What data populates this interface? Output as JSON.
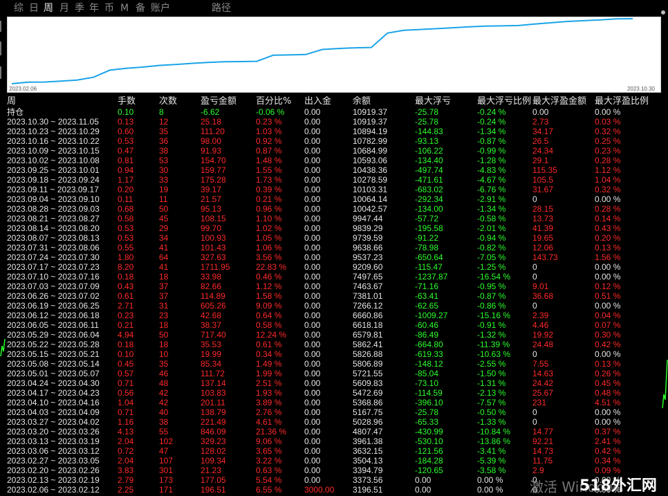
{
  "tabs": [
    {
      "label": "综"
    },
    {
      "label": "日"
    },
    {
      "label": "周",
      "active": true
    },
    {
      "label": "月"
    },
    {
      "label": "季"
    },
    {
      "label": "年"
    },
    {
      "label": "币"
    },
    {
      "label": "M"
    },
    {
      "label": "备"
    },
    {
      "label": "账户"
    },
    {
      "label": "路径"
    }
  ],
  "chart": {
    "start_date": "2023.02.06",
    "end_date": "2023.10.30",
    "line_color": "#1aa3e8",
    "values": [
      3196.51,
      3373.56,
      3394.79,
      3504.13,
      3632.15,
      3961.38,
      4807.47,
      5028.96,
      5167.75,
      5368.86,
      5472.69,
      5609.83,
      5721.55,
      5806.89,
      5826.88,
      5862.41,
      6579.81,
      6618.18,
      6660.86,
      7266.12,
      7381.01,
      7463.67,
      7497.65,
      9209.6,
      9537.23,
      9638.66,
      9739.59,
      9839.29,
      9947.44,
      10042.57,
      10064.14,
      10103.31,
      10278.59,
      10438.36,
      10593.06,
      10684.99,
      10782.99,
      10894.19,
      10919.37
    ]
  },
  "table": {
    "headers": [
      "周",
      "手数",
      "次数",
      "盈亏金额",
      "百分比%",
      "出入金",
      "余额",
      "最大浮亏",
      "最大浮亏比例",
      "最大浮盈金额",
      "最大浮盈比例"
    ],
    "rows": [
      [
        "持仓",
        "0.10",
        "8",
        "-6.62",
        "-0.06 %",
        "0.00",
        "10919.37",
        "-25.78",
        "-0.24 %",
        "0.00",
        "0.00 %"
      ],
      [
        "2023.10.30 ~ 2023.11.05",
        "0.13",
        "12",
        "25.18",
        "0.23 %",
        "0.00",
        "10919.37",
        "-25.78",
        "-0.24 %",
        "2.73",
        "0.03 %"
      ],
      [
        "2023.10.23 ~ 2023.10.29",
        "0.60",
        "35",
        "111.20",
        "1.03 %",
        "0.00",
        "10894.19",
        "-144.83",
        "-1.34 %",
        "34.17",
        "0.32 %"
      ],
      [
        "2023.10.16 ~ 2023.10.22",
        "0.53",
        "36",
        "98.00",
        "0.92 %",
        "0.00",
        "10782.99",
        "-93.13",
        "-0.87 %",
        "26.5",
        "0.25 %"
      ],
      [
        "2023.10.09 ~ 2023.10.15",
        "0.47",
        "38",
        "91.93",
        "0.87 %",
        "0.00",
        "10684.99",
        "-106.22",
        "-0.99 %",
        "24.34",
        "0.23 %"
      ],
      [
        "2023.10.02 ~ 2023.10.08",
        "0.81",
        "53",
        "154.70",
        "1.48 %",
        "0.00",
        "10593.06",
        "-134.40",
        "-1.28 %",
        "29.1",
        "0.28 %"
      ],
      [
        "2023.09.25 ~ 2023.10.01",
        "0.94",
        "30",
        "159.77",
        "1.55 %",
        "0.00",
        "10438.36",
        "-497.74",
        "-4.83 %",
        "115.35",
        "1.12 %"
      ],
      [
        "2023.09.18 ~ 2023.09.24",
        "1.17",
        "33",
        "175.28",
        "1.73 %",
        "0.00",
        "10278.59",
        "-471.61",
        "-4.67 %",
        "105.5",
        "1.04 %"
      ],
      [
        "2023.09.11 ~ 2023.09.17",
        "0.20",
        "19",
        "39.17",
        "0.39 %",
        "0.00",
        "10103.31",
        "-683.02",
        "-6.76 %",
        "31.67",
        "0.32 %"
      ],
      [
        "2023.09.04 ~ 2023.09.10",
        "0.11",
        "11",
        "21.57",
        "0.21 %",
        "0.00",
        "10064.14",
        "-292.34",
        "-2.91 %",
        "0",
        "0.00 %"
      ],
      [
        "2023.08.28 ~ 2023.09.03",
        "0.68",
        "50",
        "95.13",
        "0.96 %",
        "0.00",
        "10042.57",
        "-134.00",
        "-1.34 %",
        "28.15",
        "0.28 %"
      ],
      [
        "2023.08.21 ~ 2023.08.27",
        "0.58",
        "45",
        "108.15",
        "1.10 %",
        "0.00",
        "9947.44",
        "-57.72",
        "-0.58 %",
        "13.73",
        "0.14 %"
      ],
      [
        "2023.08.14 ~ 2023.08.20",
        "0.53",
        "29",
        "99.70",
        "1.02 %",
        "0.00",
        "9839.29",
        "-195.58",
        "-2.01 %",
        "41.39",
        "0.43 %"
      ],
      [
        "2023.08.07 ~ 2023.08.13",
        "0.53",
        "34",
        "100.93",
        "1.05 %",
        "0.00",
        "9739.59",
        "-91.22",
        "-0.94 %",
        "19.65",
        "0.20 %"
      ],
      [
        "2023.07.31 ~ 2023.08.06",
        "0.55",
        "41",
        "101.43",
        "1.06 %",
        "0.00",
        "9638.66",
        "-78.98",
        "-0.82 %",
        "12.06",
        "0.13 %"
      ],
      [
        "2023.07.24 ~ 2023.07.30",
        "1.80",
        "64",
        "327.63",
        "3.56 %",
        "0.00",
        "9537.23",
        "-650.64",
        "-7.05 %",
        "143.73",
        "1.56 %"
      ],
      [
        "2023.07.17 ~ 2023.07.23",
        "8.20",
        "41",
        "1711.95",
        "22.83 %",
        "0.00",
        "9209.60",
        "-115.47",
        "-1.25 %",
        "0",
        "0.00 %"
      ],
      [
        "2023.07.10 ~ 2023.07.16",
        "0.18",
        "18",
        "33.98",
        "0.46 %",
        "0.00",
        "7497.65",
        "-1237.87",
        "-16.54 %",
        "0",
        "0.00 %"
      ],
      [
        "2023.07.03 ~ 2023.07.09",
        "0.43",
        "37",
        "82.66",
        "1.12 %",
        "0.00",
        "7463.67",
        "-71.16",
        "-0.95 %",
        "9.01",
        "0.12 %"
      ],
      [
        "2023.06.26 ~ 2023.07.02",
        "0.61",
        "37",
        "114.89",
        "1.58 %",
        "0.00",
        "7381.01",
        "-63.41",
        "-0.87 %",
        "36.68",
        "0.51 %"
      ],
      [
        "2023.06.19 ~ 2023.06.25",
        "2.71",
        "31",
        "605.26",
        "9.09 %",
        "0.00",
        "7266.12",
        "-62.65",
        "-0.86 %",
        "0",
        "0.00 %"
      ],
      [
        "2023.06.12 ~ 2023.06.18",
        "0.23",
        "23",
        "42.68",
        "0.64 %",
        "0.00",
        "6660.86",
        "-1009.27",
        "-15.16 %",
        "2.39",
        "0.04 %"
      ],
      [
        "2023.06.05 ~ 2023.06.11",
        "0.21",
        "18",
        "38.37",
        "0.58 %",
        "0.00",
        "6618.18",
        "-60.46",
        "-0.91 %",
        "4.46",
        "0.07 %"
      ],
      [
        "2023.05.29 ~ 2023.06.04",
        "4.94",
        "50",
        "717.40",
        "12.24 %",
        "0.00",
        "6579.81",
        "-86.49",
        "-1.32 %",
        "19.92",
        "0.30 %"
      ],
      [
        "2023.05.22 ~ 2023.05.28",
        "0.18",
        "18",
        "35.53",
        "0.61 %",
        "0.00",
        "5862.41",
        "-664.80",
        "-11.39 %",
        "24.48",
        "0.42 %"
      ],
      [
        "2023.05.15 ~ 2023.05.21",
        "0.10",
        "10",
        "19.99",
        "0.34 %",
        "0.00",
        "5826.88",
        "-619.33",
        "-10.63 %",
        "0",
        "0.00 %"
      ],
      [
        "2023.05.08 ~ 2023.05.14",
        "0.45",
        "35",
        "85.34",
        "1.49 %",
        "0.00",
        "5806.89",
        "-148.12",
        "-2.55 %",
        "7.55",
        "0.13 %"
      ],
      [
        "2023.05.01 ~ 2023.05.07",
        "0.57",
        "46",
        "111.72",
        "1.99 %",
        "0.00",
        "5721.55",
        "-85.04",
        "-1.50 %",
        "14.63",
        "0.26 %"
      ],
      [
        "2023.04.24 ~ 2023.04.30",
        "0.71",
        "48",
        "137.14",
        "2.51 %",
        "0.00",
        "5609.83",
        "-73.10",
        "-1.31 %",
        "24.42",
        "0.45 %"
      ],
      [
        "2023.04.17 ~ 2023.04.23",
        "0.56",
        "42",
        "103.83",
        "1.93 %",
        "0.00",
        "5472.69",
        "-114.59",
        "-2.13 %",
        "25.67",
        "0.48 %"
      ],
      [
        "2023.04.10 ~ 2023.04.16",
        "1.04",
        "42",
        "201.11",
        "3.89 %",
        "0.00",
        "5368.86",
        "-396.10",
        "-7.57 %",
        "231",
        "4.51 %"
      ],
      [
        "2023.04.03 ~ 2023.04.09",
        "0.71",
        "40",
        "138.79",
        "2.76 %",
        "0.00",
        "5167.75",
        "-25.78",
        "-0.50 %",
        "0",
        "0.00 %"
      ],
      [
        "2023.03.27 ~ 2023.04.02",
        "1.16",
        "38",
        "221.49",
        "4.61 %",
        "0.00",
        "5028.96",
        "-65.33",
        "-1.33 %",
        "0",
        "0.00 %"
      ],
      [
        "2023.03.20 ~ 2023.03.26",
        "4.13",
        "55",
        "846.09",
        "21.36 %",
        "0.00",
        "4807.47",
        "-430.99",
        "-10.84 %",
        "14.77",
        "0.37 %"
      ],
      [
        "2023.03.13 ~ 2023.03.19",
        "2.04",
        "102",
        "329.23",
        "9.06 %",
        "0.00",
        "3961.38",
        "-530.10",
        "-13.86 %",
        "92.21",
        "2.41 %"
      ],
      [
        "2023.03.06 ~ 2023.03.12",
        "0.72",
        "47",
        "128.02",
        "3.65 %",
        "0.00",
        "3632.15",
        "-121.56",
        "-3.41 %",
        "14.73",
        "0.42 %"
      ],
      [
        "2023.02.27 ~ 2023.03.05",
        "2.04",
        "107",
        "109.34",
        "3.22 %",
        "0.00",
        "3504.13",
        "-184.28",
        "-5.39 %",
        "11.75",
        "0.34 %"
      ],
      [
        "2023.02.20 ~ 2023.02.26",
        "3.83",
        "301",
        "21.23",
        "0.63 %",
        "0.00",
        "3394.79",
        "-120.65",
        "-3.58 %",
        "2.9",
        "0.09 %"
      ],
      [
        "2023.02.13 ~ 2023.02.19",
        "2.79",
        "173",
        "177.05",
        "5.54 %",
        "0.00",
        "3373.56",
        "0.00",
        "0.00 %",
        "0",
        "0.00 %"
      ],
      [
        "2023.02.06 ~ 2023.02.12",
        "2.25",
        "171",
        "196.51",
        "6.55 %",
        "3000.00",
        "3196.51",
        "0.00",
        "0.00 %",
        "0",
        "0.00 %"
      ]
    ]
  },
  "watermark": {
    "text": "激活 Windows",
    "logo": "518外汇网"
  },
  "colors": {
    "positive": "#ff2a2a",
    "negative": "#2cff2c",
    "neutral": "#e6e6e6",
    "background": "#000000"
  }
}
